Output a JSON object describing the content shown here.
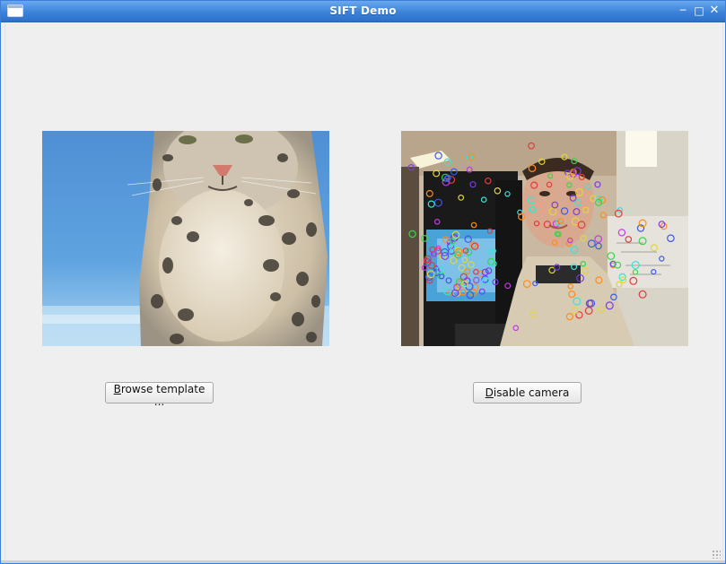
{
  "window": {
    "title": "SIFT Demo",
    "icons": {
      "app": "window-icon",
      "minimize": "minimize-icon",
      "maximize": "maximize-icon",
      "close": "close-icon"
    }
  },
  "panels": {
    "template": {
      "kind": "snow-leopard-photo"
    },
    "camera": {
      "kind": "webcam-feed-with-sift-keypoints"
    }
  },
  "buttons": {
    "browse_label_accel": "B",
    "browse_label_rest": "rowse template ...",
    "camera_label_accel": "D",
    "camera_label_rest": "isable camera"
  },
  "colors": {
    "titlebar": "#3b82d9",
    "background": "#efefef",
    "keypoints": [
      "#e23b3b",
      "#3bd24a",
      "#3b5be2",
      "#e2d63b",
      "#c03be2",
      "#3be2d6",
      "#ff8c1a",
      "#7a3be2"
    ]
  }
}
